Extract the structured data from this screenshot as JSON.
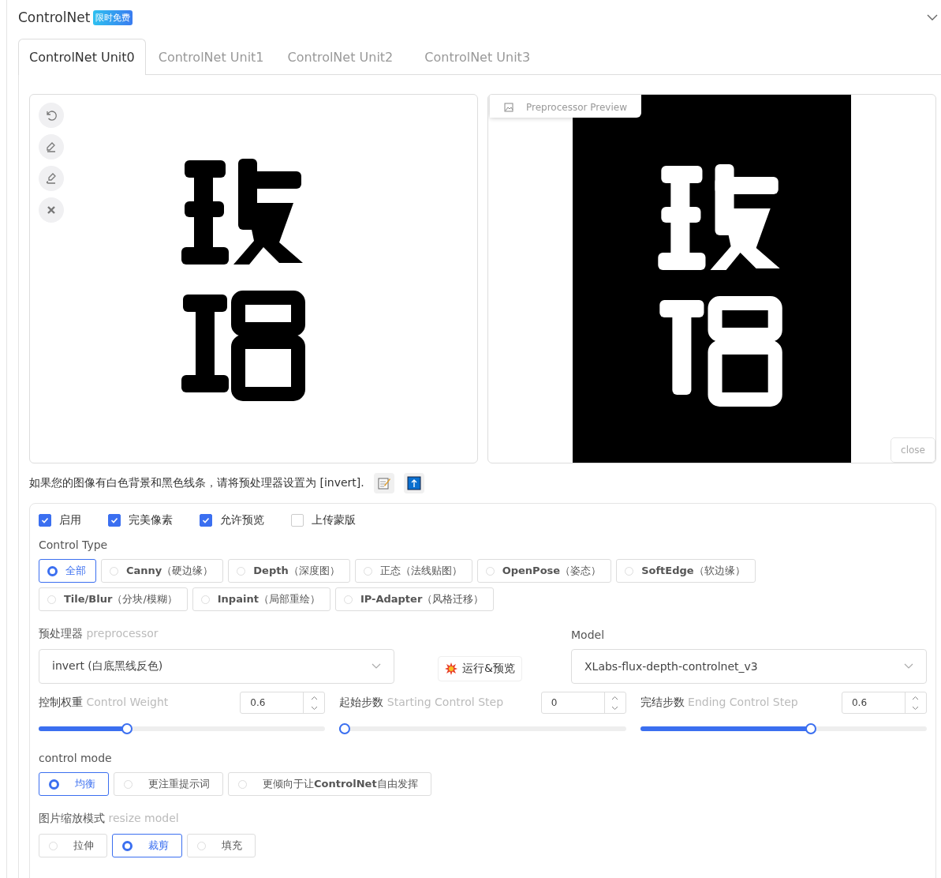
{
  "panel": {
    "title": "ControlNet",
    "badge": "限时免费",
    "expanded": true
  },
  "tabs": [
    {
      "label": "ControlNet Unit0",
      "selected": true
    },
    {
      "label": "ControlNet Unit1",
      "selected": false
    },
    {
      "label": "ControlNet Unit2",
      "selected": false
    },
    {
      "label": "ControlNet Unit3",
      "selected": false
    }
  ],
  "preview": {
    "label": "Preprocessor Preview",
    "close": "close"
  },
  "hint": "如果您的图像有白色背景和黑色线条，请将预处理器设置为 [invert].",
  "options": [
    {
      "label": "启用",
      "checked": true
    },
    {
      "label": "完美像素",
      "checked": true
    },
    {
      "label": "允许预览",
      "checked": true
    },
    {
      "label": "上传蒙版",
      "checked": false
    }
  ],
  "control_type": {
    "label": "Control Type",
    "options": [
      {
        "label": "全部",
        "selected": true
      },
      {
        "label": "**Canny**（硬边缘）",
        "selected": false
      },
      {
        "label": "**Depth**（深度图）",
        "selected": false
      },
      {
        "label": "正态（法线贴图）",
        "selected": false
      },
      {
        "label": "**OpenPose**（姿态）",
        "selected": false
      },
      {
        "label": "**SoftEdge**（软边缘）",
        "selected": false
      },
      {
        "label": "**Tile/Blur**（分块/模糊）",
        "selected": false
      },
      {
        "label": "**Inpaint**（局部重绘）",
        "selected": false
      },
      {
        "label": "**IP-Adapter**（风格迁移）",
        "selected": false
      }
    ]
  },
  "preprocessor": {
    "label": "预处理器",
    "sublabel": "preprocessor",
    "value": "invert (白底黑线反色)"
  },
  "run_button": "运行&预览",
  "model": {
    "label": "Model",
    "value": "XLabs-flux-depth-controlnet_v3"
  },
  "sliders": [
    {
      "label": "控制权重",
      "sublabel": "Control Weight",
      "value": "0.6",
      "level": 0.3
    },
    {
      "label": "起始步数",
      "sublabel": "Starting Control Step",
      "value": "0",
      "level": 0
    },
    {
      "label": "完结步数",
      "sublabel": "Ending Control Step",
      "value": "0.6",
      "level": 0.6
    }
  ],
  "control_mode": {
    "label": "control mode",
    "options": [
      {
        "label": "均衡",
        "selected": true
      },
      {
        "label": "更注重提示词",
        "selected": false
      },
      {
        "label": "更倾向于让**ControlNet**自由发挥",
        "selected": false
      }
    ]
  },
  "resize_mode": {
    "label": "图片缩放模式",
    "sublabel": "resize model",
    "options": [
      {
        "label": "拉伸",
        "selected": false
      },
      {
        "label": "裁剪",
        "selected": true
      },
      {
        "label": "填充",
        "selected": false
      }
    ]
  }
}
